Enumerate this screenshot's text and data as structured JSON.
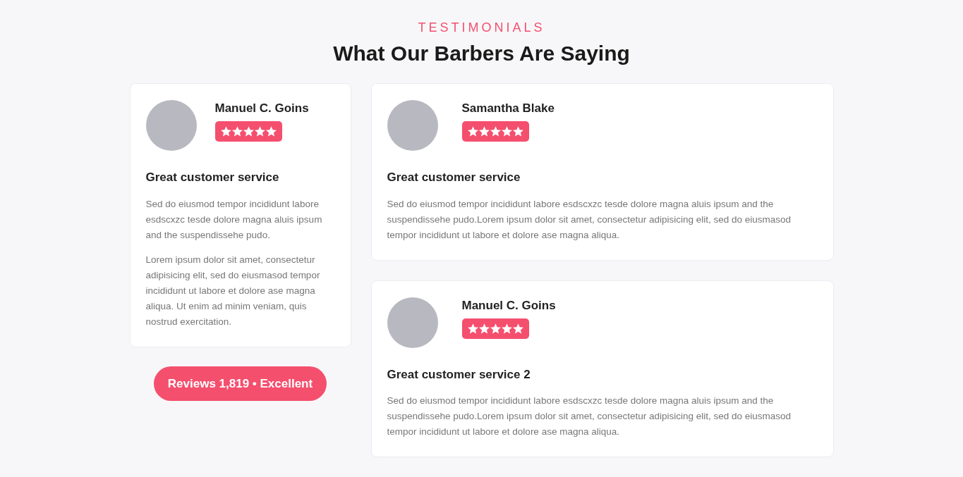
{
  "section": {
    "eyebrow": "TESTIMONIALS",
    "title": "What Our Barbers Are Saying"
  },
  "testimonials": [
    {
      "name": "Manuel C. Goins",
      "stars": 5,
      "heading": "Great customer service",
      "paragraphs": [
        "Sed do eiusmod tempor incididunt labore esdscxzc tesde dolore magna aluis ipsum and the suspendissehe pudo.",
        "Lorem ipsum dolor sit amet, consectetur adipisicing elit, sed do eiusmasod tempor incididunt ut labore et dolore ase magna aliqua. Ut enim ad minim veniam, quis nostrud exercitation."
      ]
    },
    {
      "name": "Samantha Blake",
      "stars": 5,
      "heading": "Great customer service",
      "paragraphs": [
        "Sed do eiusmod tempor incididunt labore esdscxzc tesde dolore magna aluis ipsum and the suspendissehe pudo.Lorem ipsum dolor sit amet, consectetur adipisicing elit, sed do eiusmasod tempor incididunt ut labore et dolore ase magna aliqua."
      ]
    },
    {
      "name": "Manuel C. Goins",
      "stars": 5,
      "heading": "Great customer service 2",
      "paragraphs": [
        "Sed do eiusmod tempor incididunt labore esdscxzc tesde dolore magna aluis ipsum and the suspendissehe pudo.Lorem ipsum dolor sit amet, consectetur adipisicing elit, sed do eiusmasod tempor incididunt ut labore et dolore ase magna aliqua."
      ]
    }
  ],
  "reviews_button": "Reviews 1,819 • Excellent"
}
